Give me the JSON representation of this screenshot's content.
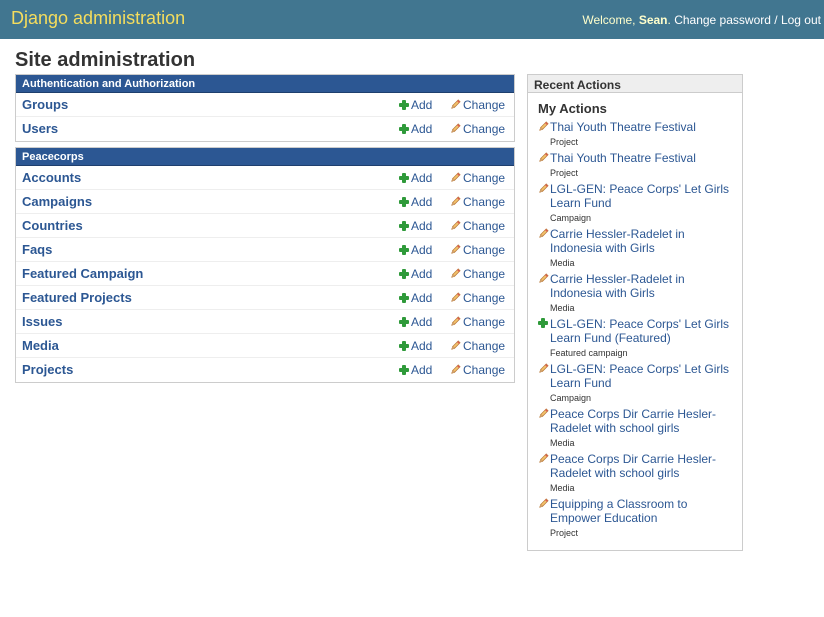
{
  "header": {
    "branding": "Django administration",
    "welcome": "Welcome,",
    "username": "Sean",
    "period": ".",
    "change_password": "Change password",
    "separator": "/",
    "logout": "Log out"
  },
  "page_title": "Site administration",
  "apps": [
    {
      "name": "Authentication and Authorization",
      "models": [
        {
          "name": "Groups",
          "add": "Add",
          "change": "Change"
        },
        {
          "name": "Users",
          "add": "Add",
          "change": "Change"
        }
      ]
    },
    {
      "name": "Peacecorps",
      "models": [
        {
          "name": "Accounts",
          "add": "Add",
          "change": "Change"
        },
        {
          "name": "Campaigns",
          "add": "Add",
          "change": "Change"
        },
        {
          "name": "Countries",
          "add": "Add",
          "change": "Change"
        },
        {
          "name": "Faqs",
          "add": "Add",
          "change": "Change"
        },
        {
          "name": "Featured Campaign",
          "add": "Add",
          "change": "Change"
        },
        {
          "name": "Featured Projects",
          "add": "Add",
          "change": "Change"
        },
        {
          "name": "Issues",
          "add": "Add",
          "change": "Change"
        },
        {
          "name": "Media",
          "add": "Add",
          "change": "Change"
        },
        {
          "name": "Projects",
          "add": "Add",
          "change": "Change"
        }
      ]
    }
  ],
  "recent_actions": {
    "caption": "Recent Actions",
    "heading": "My Actions",
    "entries": [
      {
        "title": "Thai Youth Theatre Festival",
        "type": "Project",
        "icon": "pencil-icon"
      },
      {
        "title": "Thai Youth Theatre Festival",
        "type": "Project",
        "icon": "pencil-icon"
      },
      {
        "title": "LGL-GEN: Peace Corps' Let Girls Learn Fund",
        "type": "Campaign",
        "icon": "pencil-icon"
      },
      {
        "title": "Carrie Hessler-Radelet in Indonesia with Girls",
        "type": "Media",
        "icon": "pencil-icon"
      },
      {
        "title": "Carrie Hessler-Radelet in Indonesia with Girls",
        "type": "Media",
        "icon": "pencil-icon"
      },
      {
        "title": "LGL-GEN: Peace Corps' Let Girls Learn Fund (Featured)",
        "type": "Featured campaign",
        "icon": "plus-icon"
      },
      {
        "title": "LGL-GEN: Peace Corps' Let Girls Learn Fund",
        "type": "Campaign",
        "icon": "pencil-icon"
      },
      {
        "title": "Peace Corps Dir Carrie Hesler-Radelet with school girls",
        "type": "Media",
        "icon": "pencil-icon"
      },
      {
        "title": "Peace Corps Dir Carrie Hesler-Radelet with school girls",
        "type": "Media",
        "icon": "pencil-icon"
      },
      {
        "title": "Equipping a Classroom to Empower Education",
        "type": "Project",
        "icon": "pencil-icon"
      }
    ]
  },
  "colors": {
    "header_bg": "#417690",
    "branding": "#f5dd5d",
    "caption_bg": "#2c5793",
    "link": "#2c5793",
    "add_icon": "#2f9a3a"
  }
}
